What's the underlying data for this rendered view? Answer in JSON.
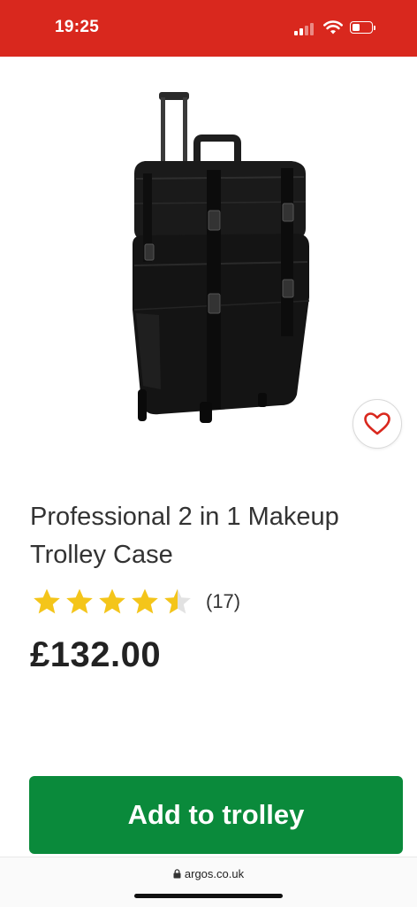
{
  "status_bar": {
    "time": "19:25",
    "background_color": "#d9281e"
  },
  "product": {
    "title_line1": "Professional 2 in 1 Makeup",
    "title_line2": "Trolley Case",
    "rating": 4.5,
    "rating_max": 5,
    "review_count": "(17)",
    "price": "£132.00",
    "image_icon": "black-trolley-case-image"
  },
  "wishlist": {
    "icon": "heart-icon",
    "color": "#d9281e"
  },
  "cta": {
    "label": "Add to trolley",
    "color": "#0a8a3b"
  },
  "browser": {
    "url": "argos.co.uk",
    "lock_icon": "lock-icon"
  },
  "colors": {
    "star": "#f4c51a",
    "star_empty": "#e2e2e2"
  }
}
